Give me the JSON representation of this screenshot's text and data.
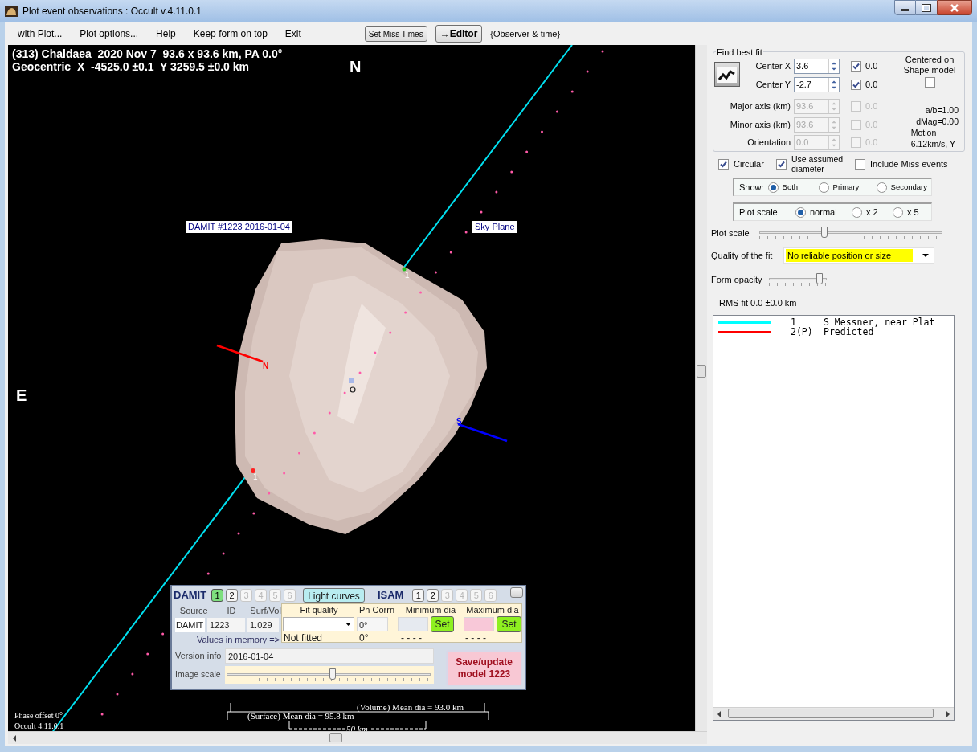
{
  "window": {
    "title": "Plot event observations : Occult v.4.11.0.1"
  },
  "menu": [
    "with Plot...",
    "Plot options...",
    "Help",
    "Keep form on top",
    "Exit"
  ],
  "toolbar": {
    "set_miss_times": "Set Miss Times",
    "editor": "→Editor",
    "observer_time": "{Observer & time}"
  },
  "plot": {
    "header_lines": [
      "(313) Chaldaea  2020 Nov 7  93.6 x 93.6 km, PA 0.0°",
      "Geocentric  X  -4525.0 ±0.1  Y 3259.5 ±0.0 km"
    ],
    "north": "N",
    "east": "E",
    "shape_label": "DAMIT #1223 2016-01-04",
    "sky_plane": "Sky Plane",
    "chord_labels": [
      "1",
      "1"
    ],
    "pole_labels": [
      "N",
      "S"
    ],
    "volume_dia": "(Volume) Mean dia = 93.0 km",
    "surface_dia": "(Surface) Mean dia = 95.8 km",
    "scale_bar": "50 km",
    "footer": [
      "Phase offset 0°",
      "Occult 4.11.0.1"
    ]
  },
  "damit_panel": {
    "damit_label": "DAMIT",
    "damit_models": [
      {
        "label": "1",
        "selected": true,
        "disabled": false
      },
      {
        "label": "2",
        "selected": false,
        "disabled": false
      },
      {
        "label": "3",
        "selected": false,
        "disabled": true
      },
      {
        "label": "4",
        "selected": false,
        "disabled": true
      },
      {
        "label": "5",
        "selected": false,
        "disabled": true
      },
      {
        "label": "6",
        "selected": false,
        "disabled": true
      }
    ],
    "light_curves": "Light curves",
    "isam_label": "ISAM",
    "isam_models": [
      {
        "label": "1",
        "selected": false,
        "disabled": false
      },
      {
        "label": "2",
        "selected": false,
        "disabled": false
      },
      {
        "label": "3",
        "selected": false,
        "disabled": true
      },
      {
        "label": "4",
        "selected": false,
        "disabled": true
      },
      {
        "label": "5",
        "selected": false,
        "disabled": true
      },
      {
        "label": "6",
        "selected": false,
        "disabled": true
      }
    ],
    "columns": [
      "Source",
      "ID",
      "Surf/Vol"
    ],
    "source": "DAMIT",
    "id": "1223",
    "surf_vol": "1.029",
    "fit_columns": [
      "Fit quality",
      "Ph Corrn",
      "Minimum dia",
      "Maximum dia"
    ],
    "ph_corrn": "0°",
    "set_buttons": [
      "Set",
      "Set"
    ],
    "memory_label": "Values in memory =>",
    "memory_values": [
      "Not fitted",
      "0°",
      "- - - -",
      "- - - -"
    ],
    "version_label": "Version info",
    "version": "2016-01-04",
    "image_scale_label": "Image scale",
    "image_scale": {
      "level": 0.52
    },
    "save_button": "Save/update model 1223"
  },
  "fit_panel": {
    "title": "Find best fit",
    "params": [
      {
        "label": "Center X",
        "value": "3.6",
        "checked": true,
        "reading": "0.0",
        "disabled": false
      },
      {
        "label": "Center Y",
        "value": "-2.7",
        "checked": true,
        "reading": "0.0",
        "disabled": false
      },
      {
        "label": "Major axis (km)",
        "value": "93.6",
        "checked": false,
        "reading": "0.0",
        "disabled": true
      },
      {
        "label": "Minor axis (km)",
        "value": "93.6",
        "checked": false,
        "reading": "0.0",
        "disabled": true
      },
      {
        "label": "Orientation",
        "value": "0.0",
        "checked": false,
        "reading": "0.0",
        "disabled": true
      }
    ],
    "centered": {
      "label": "Centered on Shape model",
      "checked": false
    },
    "info": [
      "a/b=1.00",
      "dMag=0.00",
      "Motion",
      "6.12km/s, Y"
    ],
    "options": [
      {
        "label": "Circular",
        "checked": true
      },
      {
        "label": "Use assumed diameter",
        "checked": true
      },
      {
        "label": "Include Miss events",
        "checked": false
      }
    ],
    "show": {
      "label": "Show:",
      "options": [
        {
          "label": "Both",
          "selected": true
        },
        {
          "label": "Primary",
          "selected": false
        },
        {
          "label": "Secondary",
          "selected": false
        }
      ]
    },
    "plot_scale_radio": {
      "label": "Plot scale",
      "options": [
        {
          "label": "normal",
          "selected": true
        },
        {
          "label": "x 2",
          "selected": false
        },
        {
          "label": "x 5",
          "selected": false
        }
      ]
    },
    "plot_scale_slider": {
      "label": "Plot scale",
      "level": 0.35
    },
    "quality": {
      "label": "Quality of the fit",
      "value": "No reliable position or size"
    },
    "opacity": {
      "label": "Form opacity",
      "level": 0.92
    },
    "rms": "RMS fit 0.0 ±0.0 km",
    "legend": [
      {
        "color": "#00ffff",
        "number": "1",
        "name": "S Messner, near Plat"
      },
      {
        "color": "#ff0000",
        "number": "2(P)",
        "name": "Predicted"
      }
    ]
  }
}
